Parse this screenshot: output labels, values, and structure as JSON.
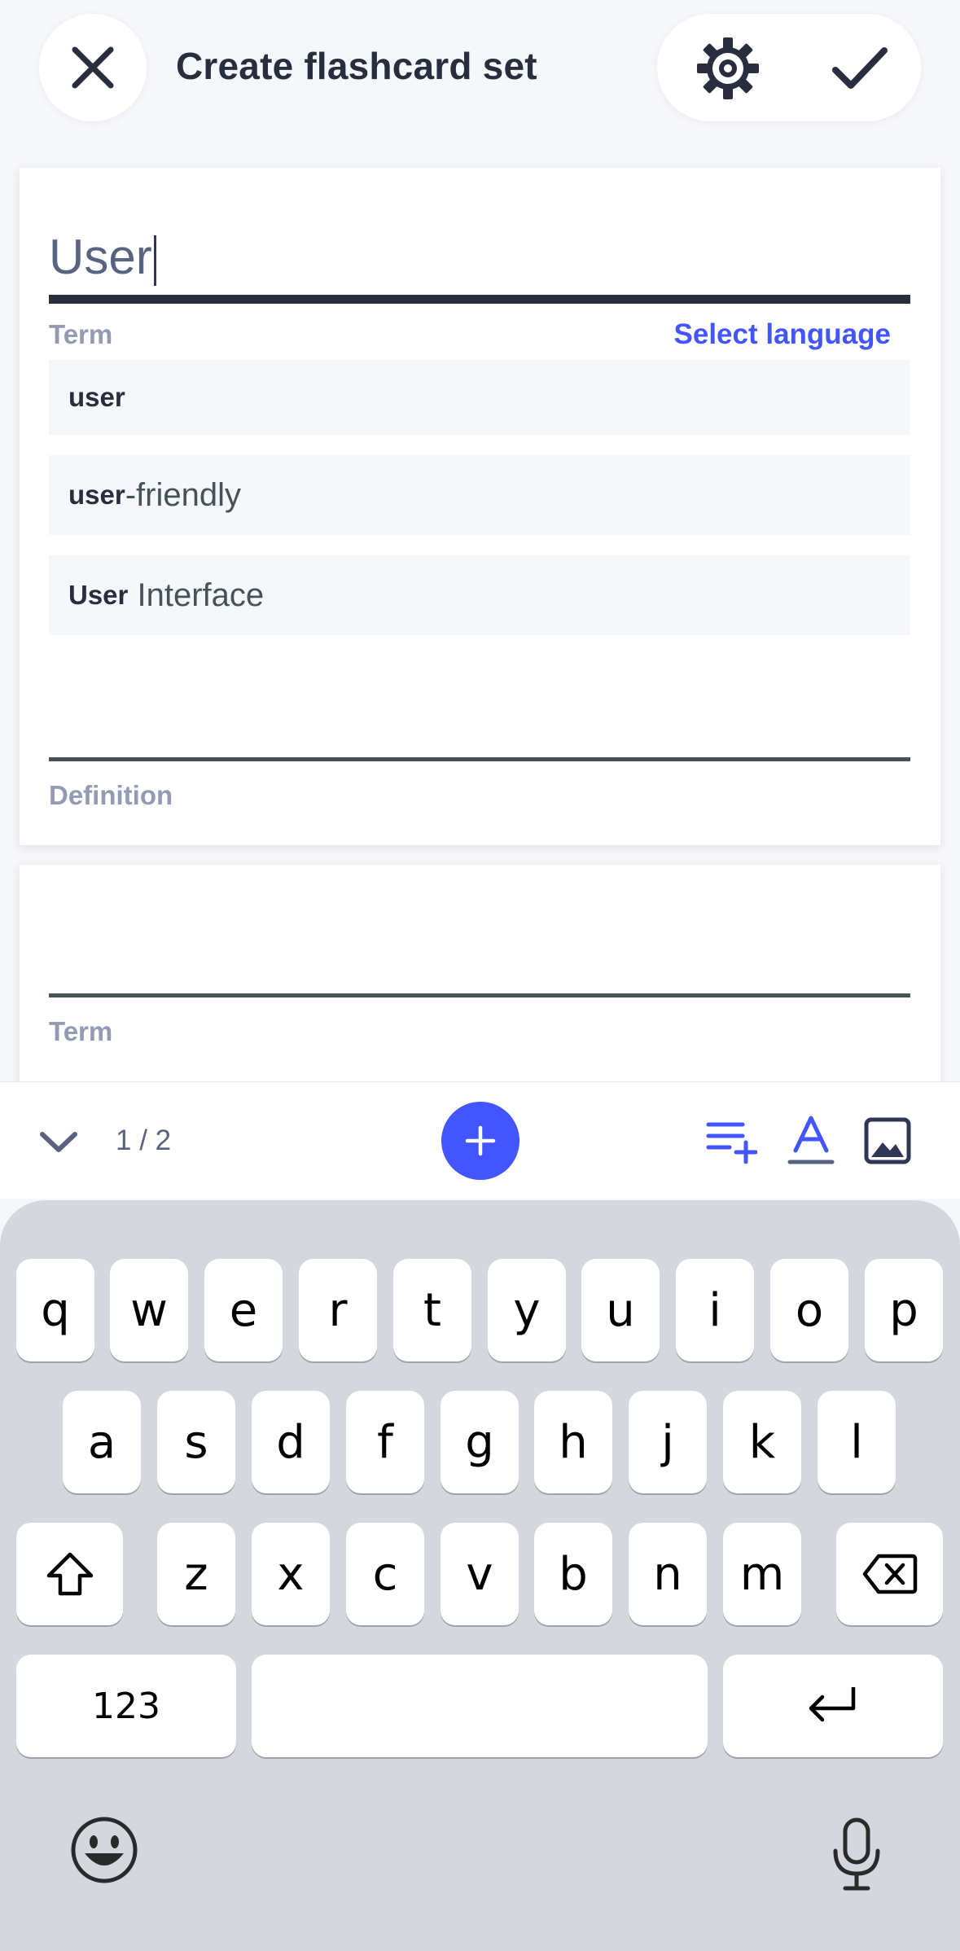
{
  "header": {
    "title": "Create flashcard set",
    "close_icon": "close-icon",
    "settings_icon": "gear-icon",
    "done_icon": "checkmark-icon"
  },
  "card_1": {
    "term_value": "User",
    "term_label": "Term",
    "select_language": "Select language",
    "suggestions": [
      {
        "match": "user",
        "rest": ""
      },
      {
        "match": "user",
        "rest": "-friendly"
      },
      {
        "match": "User",
        "rest": " Interface"
      }
    ],
    "definition_label": "Definition"
  },
  "card_2": {
    "term_label": "Term"
  },
  "toolbar": {
    "page_count": "1 / 2",
    "icons": [
      "chevron-down-icon",
      "plus-icon",
      "insert-below-icon",
      "text-format-icon",
      "image-icon"
    ]
  },
  "keyboard": {
    "row1": [
      "q",
      "w",
      "e",
      "r",
      "t",
      "y",
      "u",
      "i",
      "o",
      "p"
    ],
    "row2": [
      "a",
      "s",
      "d",
      "f",
      "g",
      "h",
      "j",
      "k",
      "l"
    ],
    "row3": [
      "z",
      "x",
      "c",
      "v",
      "b",
      "n",
      "m"
    ],
    "numbers_key": "123",
    "space_key": "",
    "icons": [
      "shift-icon",
      "backspace-icon",
      "return-icon",
      "emoji-icon",
      "microphone-icon"
    ]
  },
  "colors": {
    "accent": "#4255ff",
    "background": "#f6f7fb",
    "text_dark": "#282e3e",
    "label_gray": "#939bb4",
    "keyboard_bg": "#d5d7de"
  }
}
